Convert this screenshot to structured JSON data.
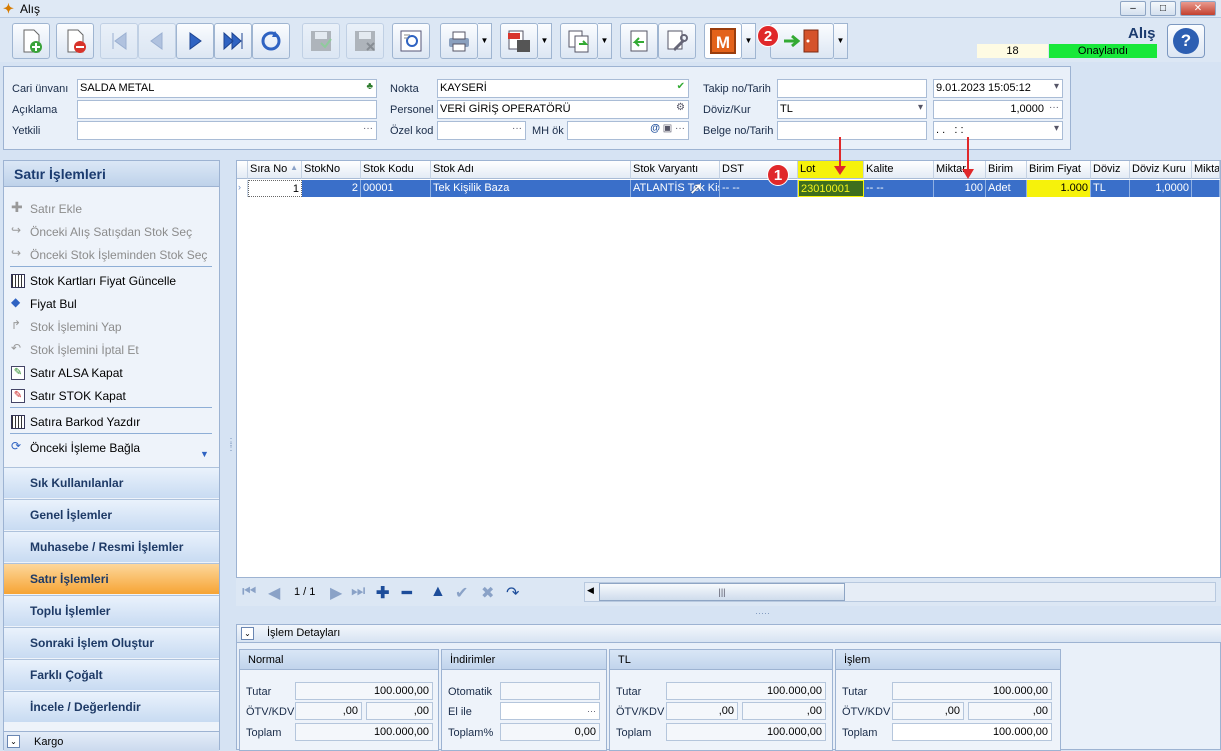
{
  "window": {
    "title": "Alış",
    "min": "–",
    "max": "□",
    "close": "✕"
  },
  "header": {
    "page_title": "Alış",
    "record_no": "18",
    "status": "Onaylandı",
    "help": "?",
    "menu_letter": "M",
    "marker_1": "1",
    "marker_2": "2"
  },
  "form": {
    "cari_label": "Cari ünvanı",
    "cari_value": "SALDA METAL",
    "aciklama_label": "Açıklama",
    "aciklama_value": "",
    "yetkili_label": "Yetkili",
    "yetkili_value": "",
    "nokta_label": "Nokta",
    "nokta_value": "KAYSERİ",
    "personel_label": "Personel",
    "personel_value": "VERİ GİRİŞ OPERATÖRÜ",
    "ozelkod_label": "Özel kod",
    "ozelkod_value": "",
    "mhok_label": "MH ök",
    "mhok_value": "",
    "takip_label": "Takip no/Tarih",
    "takip_value": "",
    "tarih_value": "9.01.2023 15:05:12",
    "doviz_label": "Döviz/Kur",
    "doviz_value": "TL",
    "kur_value": "1,0000",
    "belge_label": "Belge no/Tarih",
    "belge_value": "",
    "belge_tarih_value": ". .   : :",
    "ellipsis": "···",
    "at": "@"
  },
  "left_panel": {
    "title": "Satır İşlemleri",
    "items": [
      {
        "label": "Satır Ekle",
        "enabled": false
      },
      {
        "label": "Önceki Alış Satışdan Stok Seç",
        "enabled": false
      },
      {
        "label": "Önceki Stok İşleminden Stok Seç",
        "enabled": false
      },
      {
        "label": "Stok Kartları Fiyat Güncelle",
        "enabled": true
      },
      {
        "label": "Fiyat Bul",
        "enabled": true
      },
      {
        "label": "Stok İşlemini Yap",
        "enabled": false
      },
      {
        "label": "Stok İşlemini İptal Et",
        "enabled": false
      },
      {
        "label": "Satır ALSA Kapat",
        "enabled": true
      },
      {
        "label": "Satır STOK Kapat",
        "enabled": true
      },
      {
        "label": "Satıra Barkod Yazdır",
        "enabled": true
      },
      {
        "label": "Önceki İşleme Bağla",
        "enabled": true
      }
    ],
    "nav": [
      "Sık Kullanılanlar",
      "Genel İşlemler",
      "Muhasebe / Resmi İşlemler",
      "Satır İşlemleri",
      "Toplu İşlemler",
      "Sonraki İşlem Oluştur",
      "Farklı Çoğalt",
      "İncele / Değerlendir"
    ],
    "active_nav": "Satır İşlemleri",
    "kargo": "Kargo"
  },
  "grid": {
    "columns": [
      "Sıra No",
      "StokNo",
      "Stok Kodu",
      "Stok Adı",
      "Stok Varyantı",
      "DST",
      "Lot",
      "Kalite",
      "Miktar",
      "Birim",
      "Birim Fiyat",
      "Döviz",
      "Döviz Kuru",
      "Miktar"
    ],
    "row": {
      "sira": "1",
      "stokno": "2",
      "stokkodu": "00001",
      "stokadi": "Tek Kişilik Baza",
      "varyant": "ATLANTİS Tek Kiş",
      "dst": "-- --",
      "lot": "23010001",
      "kalite": "-- --",
      "miktar": "100",
      "birim": "Adet",
      "birimfiyat": "1.000",
      "doviz": "TL",
      "dovizkuru": "1,0000"
    },
    "pager_text": "1 / 1",
    "scroll_grip": "|||",
    "splitter": "·····"
  },
  "details": {
    "title": "İşlem Detayları",
    "normal": {
      "title": "Normal",
      "tutar_label": "Tutar",
      "tutar": "100.000,00",
      "otv_label": "ÖTV/KDV",
      "otv": ",00",
      "kdv": ",00",
      "toplam_label": "Toplam",
      "toplam": "100.000,00"
    },
    "indirim": {
      "title": "İndirimler",
      "oto_label": "Otomatik",
      "oto": "",
      "elile_label": "El ile",
      "elile": "",
      "toplam_label": "Toplam%",
      "toplam": "0,00"
    },
    "tl": {
      "title": "TL",
      "tutar_label": "Tutar",
      "tutar": "100.000,00",
      "otv_label": "ÖTV/KDV",
      "otv": ",00",
      "kdv": ",00",
      "toplam_label": "Toplam",
      "toplam": "100.000,00"
    },
    "islem": {
      "title": "İşlem",
      "tutar_label": "Tutar",
      "tutar": "100.000,00",
      "otv_label": "ÖTV/KDV",
      "otv": ",00",
      "kdv": ",00",
      "toplam_label": "Toplam",
      "toplam": "100.000,00"
    }
  }
}
